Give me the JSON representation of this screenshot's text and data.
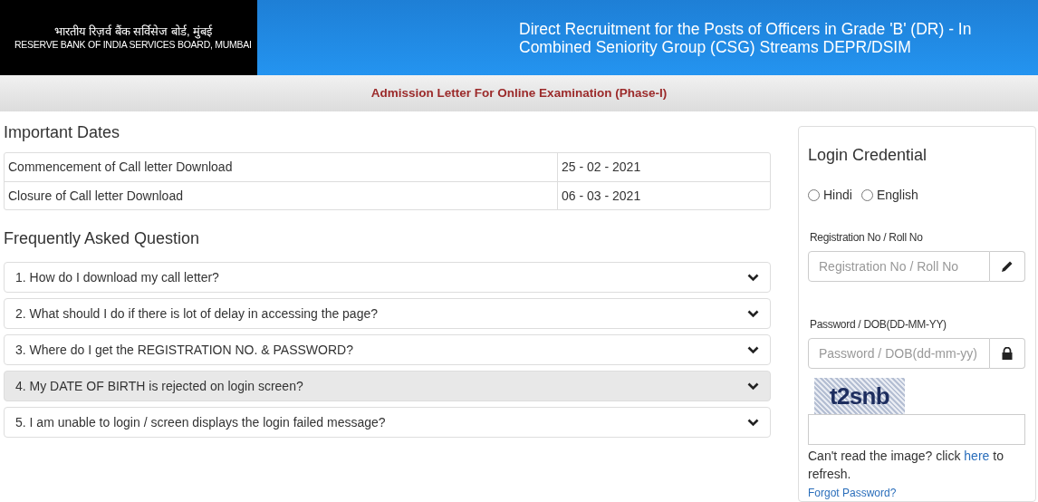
{
  "header": {
    "logo_hindi": "भारतीय रिज़र्व बैंक सर्विसेज बोर्ड, मुंबई",
    "logo_english": "RESERVE BANK OF INDIA SERVICES BOARD, MUMBAI",
    "title": "Direct Recruitment for the Posts of Officers in Grade 'B' (DR) - In Combined Seniority Group (CSG) Streams DEPR/DSIM"
  },
  "subtitle": "Admission Letter For Online Examination (Phase-I)",
  "important_dates": {
    "heading": "Important Dates",
    "rows": [
      {
        "label": "Commencement of Call letter Download",
        "date": "25 - 02 - 2021"
      },
      {
        "label": "Closure of Call letter Download",
        "date": "06 - 03 - 2021"
      }
    ]
  },
  "faq": {
    "heading": "Frequently Asked Question",
    "items": [
      {
        "question": "1. How do I download my call letter?",
        "highlighted": false
      },
      {
        "question": "2. What should I do if there is lot of delay in accessing the page?",
        "highlighted": false
      },
      {
        "question": "3. Where do I get the REGISTRATION NO. & PASSWORD?",
        "highlighted": false
      },
      {
        "question": "4. My DATE OF BIRTH is rejected on login screen?",
        "highlighted": true
      },
      {
        "question": "5. I am unable to login / screen displays the login failed message?",
        "highlighted": false
      }
    ]
  },
  "login": {
    "heading": "Login Credential",
    "languages": [
      {
        "label": "Hindi",
        "selected": false
      },
      {
        "label": "English",
        "selected": false
      }
    ],
    "fields": [
      {
        "label": "Registration No / Roll No",
        "placeholder": "Registration No / Roll No",
        "kind": "pencil"
      },
      {
        "label": "Password / DOB(DD-MM-YY)",
        "placeholder": "Password / DOB(dd-mm-yy)",
        "kind": "lock"
      }
    ],
    "captcha": "t2snb",
    "refresh_before": "Can't read the image? click",
    "refresh_link": "here",
    "refresh_after": "to refresh.",
    "forgot": "Forgot Password?"
  }
}
